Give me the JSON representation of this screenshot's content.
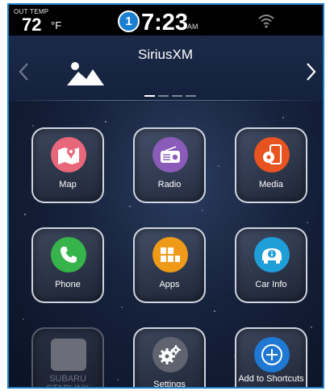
{
  "status_bar": {
    "out_temp_label": "OUT TEMP",
    "temperature": "72",
    "temp_unit": "°F",
    "callout_number": "1",
    "time": "7:23",
    "ampm": "AM",
    "wifi_icon": "wifi-icon"
  },
  "source_banner": {
    "title": "SiriusXM",
    "art_icon": "image-placeholder-icon",
    "page_count": 4,
    "active_page": 1
  },
  "tiles": [
    {
      "label": "Map",
      "icon": "map-pin-icon",
      "color": "#e8677a"
    },
    {
      "label": "Radio",
      "icon": "radio-icon",
      "color": "#8a5bb8"
    },
    {
      "label": "Media",
      "icon": "media-device-icon",
      "color": "#e8541f"
    },
    {
      "label": "Phone",
      "icon": "phone-icon",
      "color": "#36b34a"
    },
    {
      "label": "Apps",
      "icon": "apps-grid-icon",
      "color": "#f09a1a"
    },
    {
      "label": "Car Info",
      "icon": "car-info-icon",
      "color": "#1f9ed8"
    },
    {
      "label": "SUBARU STARLINK",
      "icon": "starlink-square-icon",
      "color": "#6b6e78",
      "disabled": true
    },
    {
      "label": "Settings",
      "icon": "gears-icon",
      "color": "#5f6470"
    },
    {
      "label": "Add to Shortcuts",
      "icon": "plus-circle-icon",
      "color": "#1f78d1"
    }
  ]
}
